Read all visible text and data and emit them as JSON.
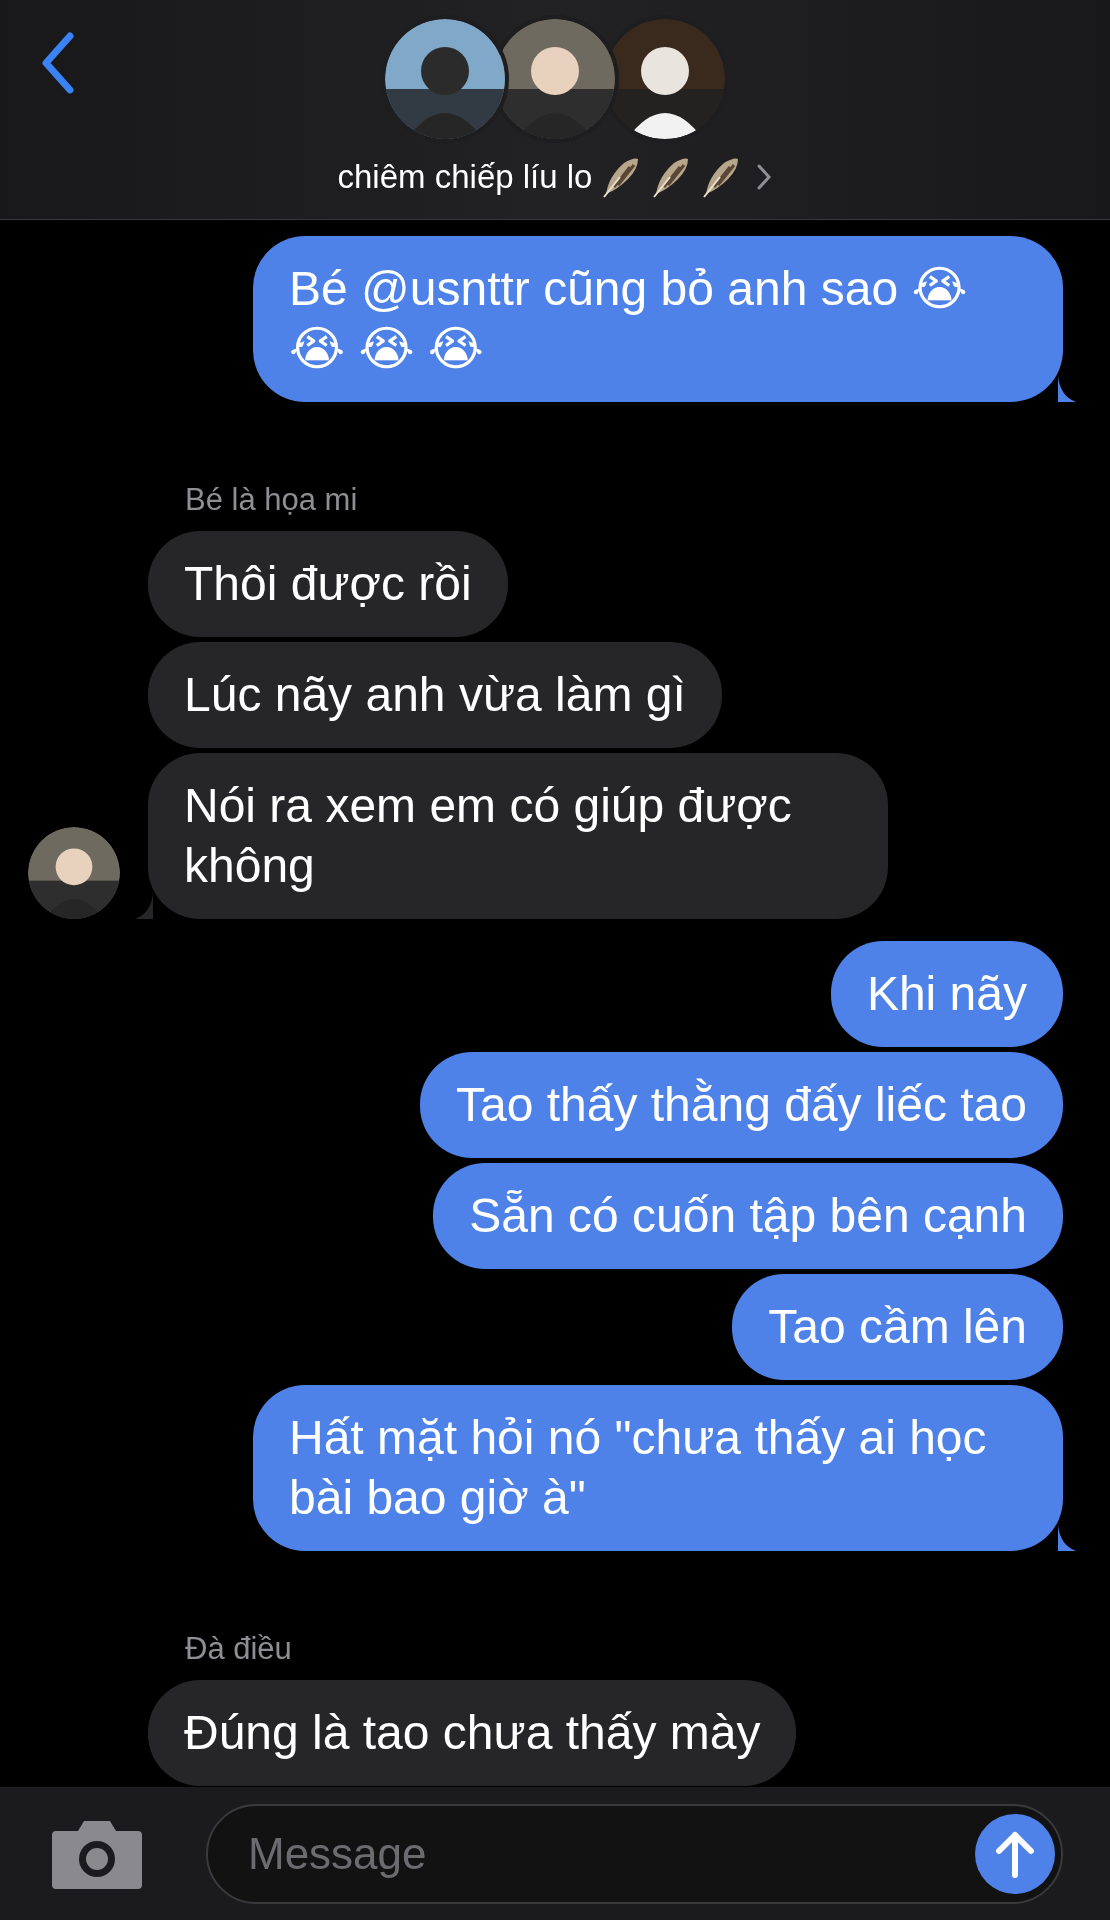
{
  "header": {
    "title": "chiêm chiếp líu lo"
  },
  "groups": [
    {
      "kind": "sent",
      "messages": [
        "Bé @usnttr cũng bỏ anh sao 😭 😭 😭 😭"
      ]
    },
    {
      "kind": "received",
      "sender": "Bé là họa mi",
      "avatar": true,
      "messages": [
        "Thôi được rồi",
        "Lúc nãy anh vừa làm gì",
        "Nói ra xem em có giúp được không"
      ]
    },
    {
      "kind": "sent",
      "messages": [
        "Khi nãy",
        "Tao thấy thằng đấy liếc tao",
        "Sẵn có cuốn tập bên cạnh",
        "Tao cầm lên",
        "Hất mặt hỏi nó \"chưa thấy ai học bài bao giờ à\""
      ]
    },
    {
      "kind": "received",
      "sender": "Đà điều",
      "avatar": false,
      "messages": [
        "Đúng là tao chưa thấy mày"
      ]
    }
  ],
  "composer": {
    "placeholder": "Message"
  }
}
